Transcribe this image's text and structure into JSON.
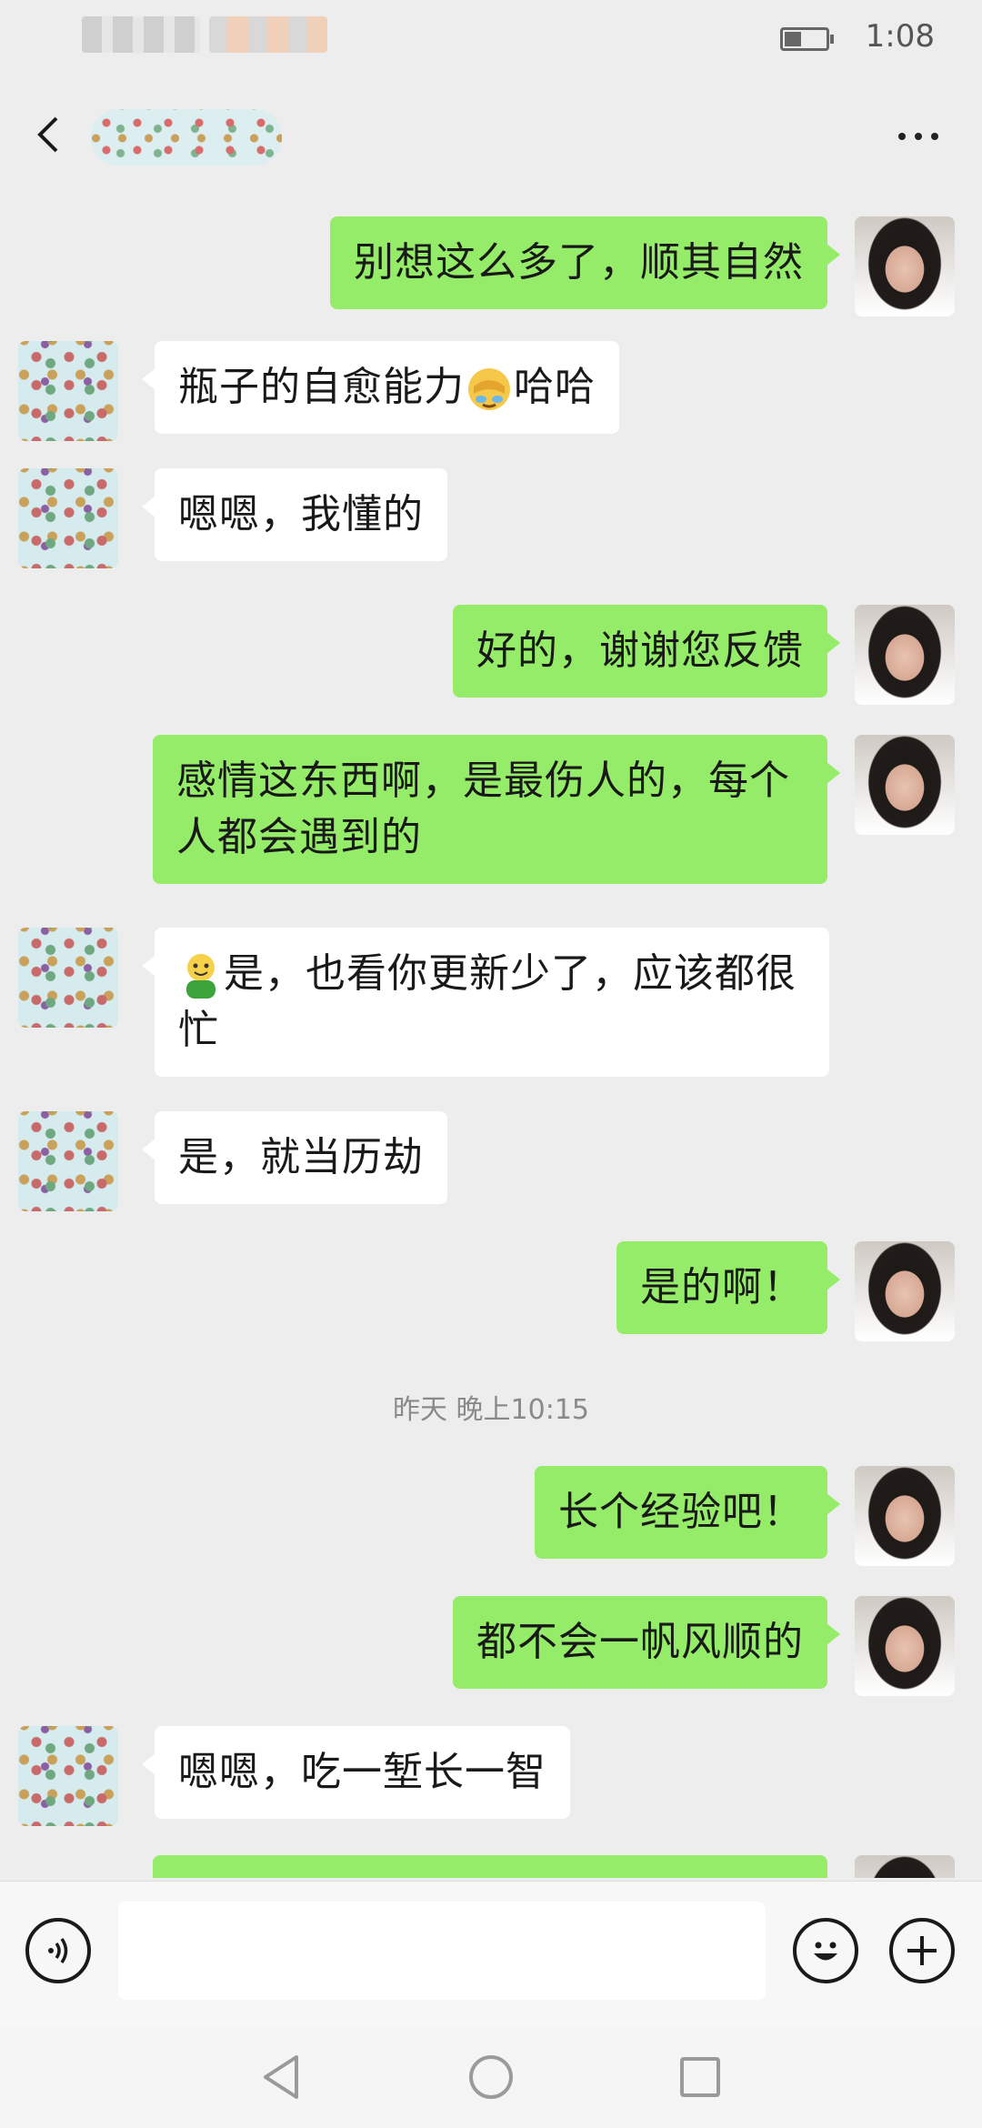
{
  "status_bar": {
    "time": "1:08"
  },
  "messages": [
    {
      "side": "me",
      "text": "别想这么多了，顺其自然"
    },
    {
      "side": "them",
      "text": "瓶子的自愈能力",
      "emoji": "facepalm-cry-emoji",
      "text_after": "哈哈"
    },
    {
      "side": "them",
      "text": "嗯嗯，我懂的"
    },
    {
      "side": "me",
      "text": "好的，谢谢您反馈"
    },
    {
      "side": "me",
      "line1": "感情这东西啊，是最伤人的，每个",
      "line2": "人都会遇到的"
    },
    {
      "side": "them",
      "emoji": "green-smiley-emoji",
      "line1": "是，也看你更新少了，应该都很",
      "line2": "忙"
    },
    {
      "side": "them",
      "text": "是，就当历劫"
    },
    {
      "side": "me",
      "text": "是的啊！"
    },
    {
      "side": "me",
      "text": "长个经验吧！"
    },
    {
      "side": "me",
      "text": "都不会一帆风顺的"
    },
    {
      "side": "them",
      "text": "嗯嗯，吃一堑长一智"
    }
  ],
  "timestamp": "昨天 晚上10:15",
  "input_bar": {
    "placeholder": ""
  },
  "colors": {
    "me_bubble": "#95ec69",
    "them_bubble": "#ffffff",
    "background": "#ededed"
  }
}
